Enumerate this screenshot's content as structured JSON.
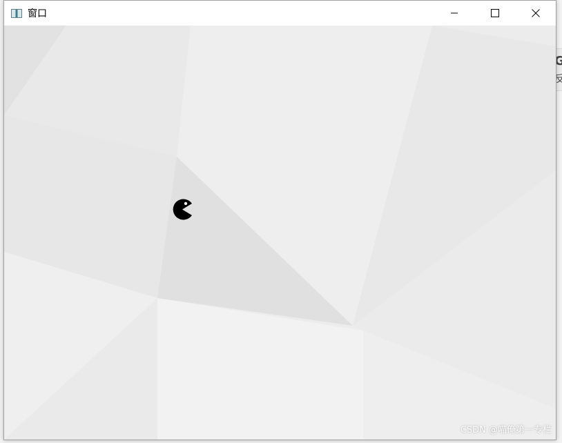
{
  "window": {
    "title": "窗口",
    "icon": "app-window-icon",
    "controls": [
      "minimize-icon",
      "maximize-icon",
      "close-icon"
    ]
  },
  "canvas": {
    "sprite": "pacman",
    "sprite_color": "#000000",
    "background_color": "#ececec"
  },
  "desktop": {
    "peek_glyph_1": "G",
    "peek_glyph_2": "反"
  },
  "watermark": "CSDN @喵俺第一专栏"
}
